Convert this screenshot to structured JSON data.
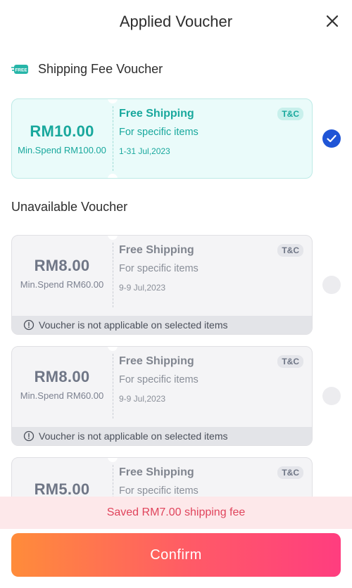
{
  "header": {
    "title": "Applied Voucher"
  },
  "sections": {
    "shipping_title": "Shipping Fee Voucher",
    "free_badge": "FREE",
    "unavailable_title": "Unavailable Voucher"
  },
  "applied_voucher": {
    "amount": "RM10.00",
    "min_spend": "Min.Spend RM100.00",
    "type": "Free Shipping",
    "scope": "For specific items",
    "date": "1-31 Jul,2023",
    "tc": "T&C",
    "selected": true
  },
  "unavailable_vouchers": [
    {
      "amount": "RM8.00",
      "min_spend": "Min.Spend RM60.00",
      "type": "Free Shipping",
      "scope": "For specific items",
      "date": "9-9 Jul,2023",
      "tc": "T&C",
      "warning": "Voucher is not applicable on selected items"
    },
    {
      "amount": "RM8.00",
      "min_spend": "Min.Spend RM60.00",
      "type": "Free Shipping",
      "scope": "For specific items",
      "date": "9-9 Jul,2023",
      "tc": "T&C",
      "warning": "Voucher is not applicable on selected items"
    },
    {
      "amount": "RM5.00",
      "type": "Free Shipping",
      "scope": "For specific items",
      "tc": "T&C"
    }
  ],
  "saved_message": "Saved RM7.00 shipping fee",
  "confirm_label": "Confirm",
  "colors": {
    "teal": "#19a89d",
    "blue_check": "#1f55d6",
    "saved_text": "#e0445c",
    "button_start": "#ff8c3a",
    "button_end": "#ff3d7f"
  }
}
